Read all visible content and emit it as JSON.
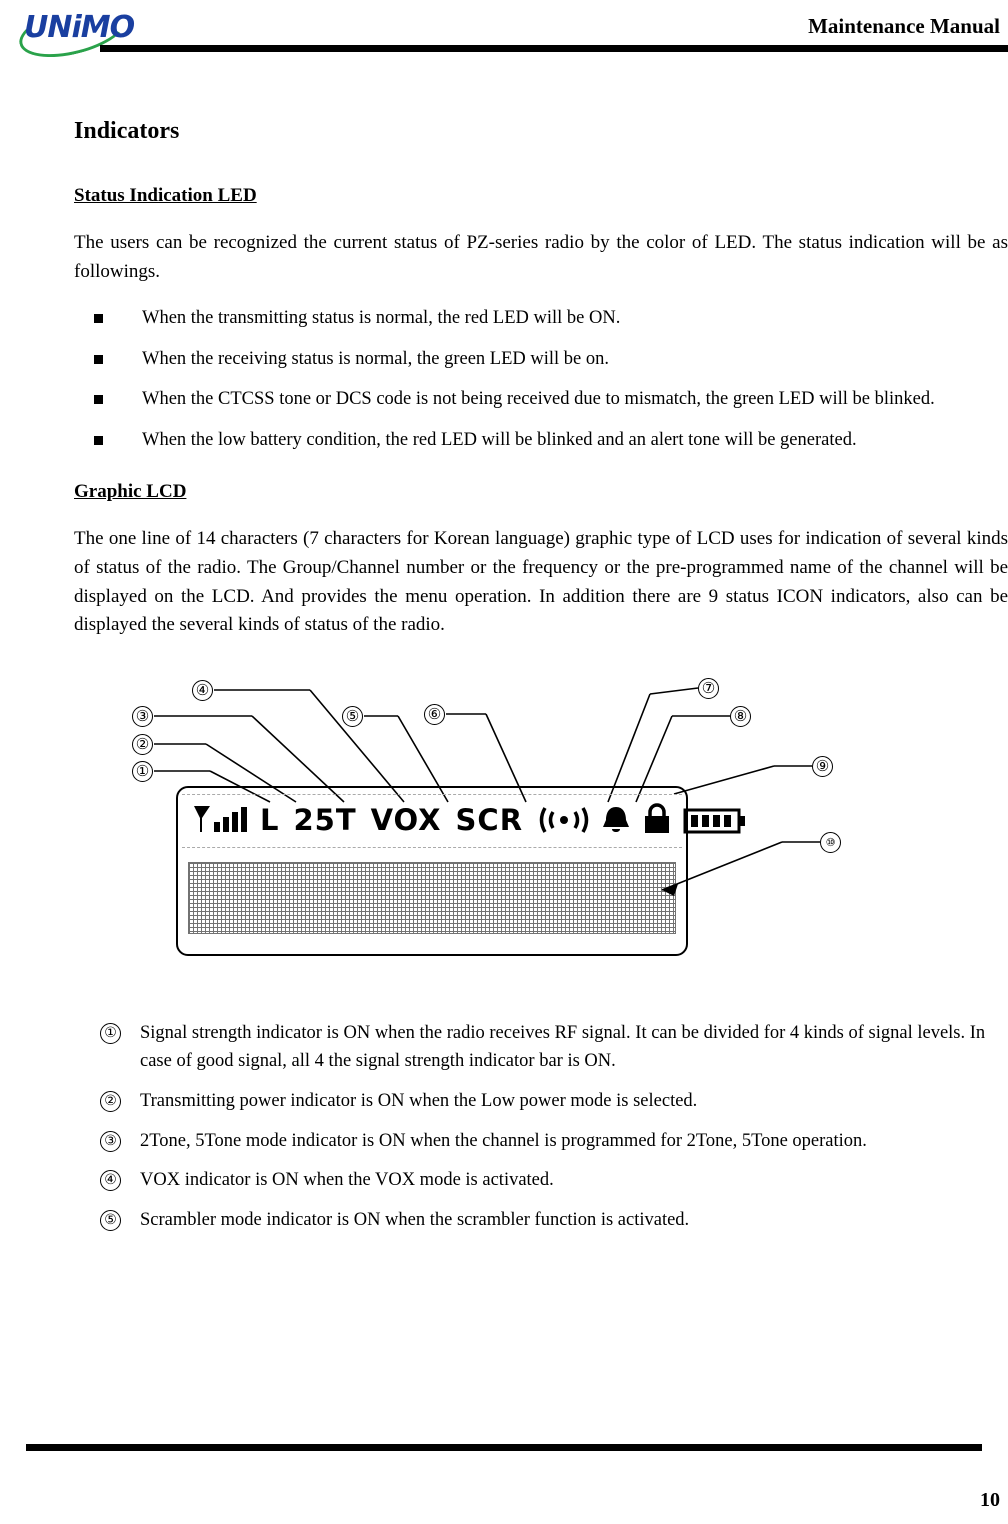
{
  "header": {
    "logo_text": "UNiMO",
    "manual_title": "Maintenance Manual"
  },
  "footer": {
    "page_number": "10"
  },
  "section": {
    "title": "Indicators",
    "sub1": {
      "heading": "Status Indication LED",
      "intro": "The users can be recognized the current status of PZ-series radio by the color of LED. The status indication will be as followings.",
      "bullets": [
        "When the transmitting status is normal, the red LED will be ON.",
        "When the receiving status is normal, the green LED will be on.",
        "When the CTCSS tone or DCS code is not being received due to mismatch, the green LED will be blinked.",
        "When the low battery condition, the red LED will be blinked and an alert tone will be generated."
      ]
    },
    "sub2": {
      "heading": "Graphic LCD",
      "intro": "The one line of 14 characters (7 characters for Korean language) graphic type of LCD uses for indication of several kinds of status of the radio. The Group/Channel number or the frequency or the pre-programmed name of the channel will be displayed on the LCD. And provides the menu operation. In addition there are 9 status ICON indicators, also can be displayed the several kinds of status of the radio."
    }
  },
  "figure": {
    "callouts": [
      {
        "id": "1",
        "label": "①"
      },
      {
        "id": "2",
        "label": "②"
      },
      {
        "id": "3",
        "label": "③"
      },
      {
        "id": "4",
        "label": "④"
      },
      {
        "id": "5",
        "label": "⑤"
      },
      {
        "id": "6",
        "label": "⑥"
      },
      {
        "id": "7",
        "label": "⑦"
      },
      {
        "id": "8",
        "label": "⑧"
      },
      {
        "id": "9",
        "label": "⑨"
      },
      {
        "id": "10",
        "label": "⑩"
      }
    ],
    "lcd_icons": {
      "low_power": "L",
      "tone_mode": "25T",
      "vox": "VOX",
      "scrambler": "SCR"
    }
  },
  "descriptions": [
    {
      "num": "①",
      "text": "Signal strength indicator is ON when the radio receives RF signal. It can be divided for 4 kinds of signal levels. In case of good signal, all 4 the signal strength indicator bar is ON."
    },
    {
      "num": "②",
      "text": "Transmitting power indicator is ON when the Low power mode is selected."
    },
    {
      "num": "③",
      "text": "2Tone, 5Tone mode indicator is ON when the channel is programmed for 2Tone, 5Tone operation."
    },
    {
      "num": "④",
      "text": "VOX indicator is ON when the VOX mode is activated."
    },
    {
      "num": "⑤",
      "text": "Scrambler mode indicator is ON when the scrambler function is activated."
    }
  ]
}
